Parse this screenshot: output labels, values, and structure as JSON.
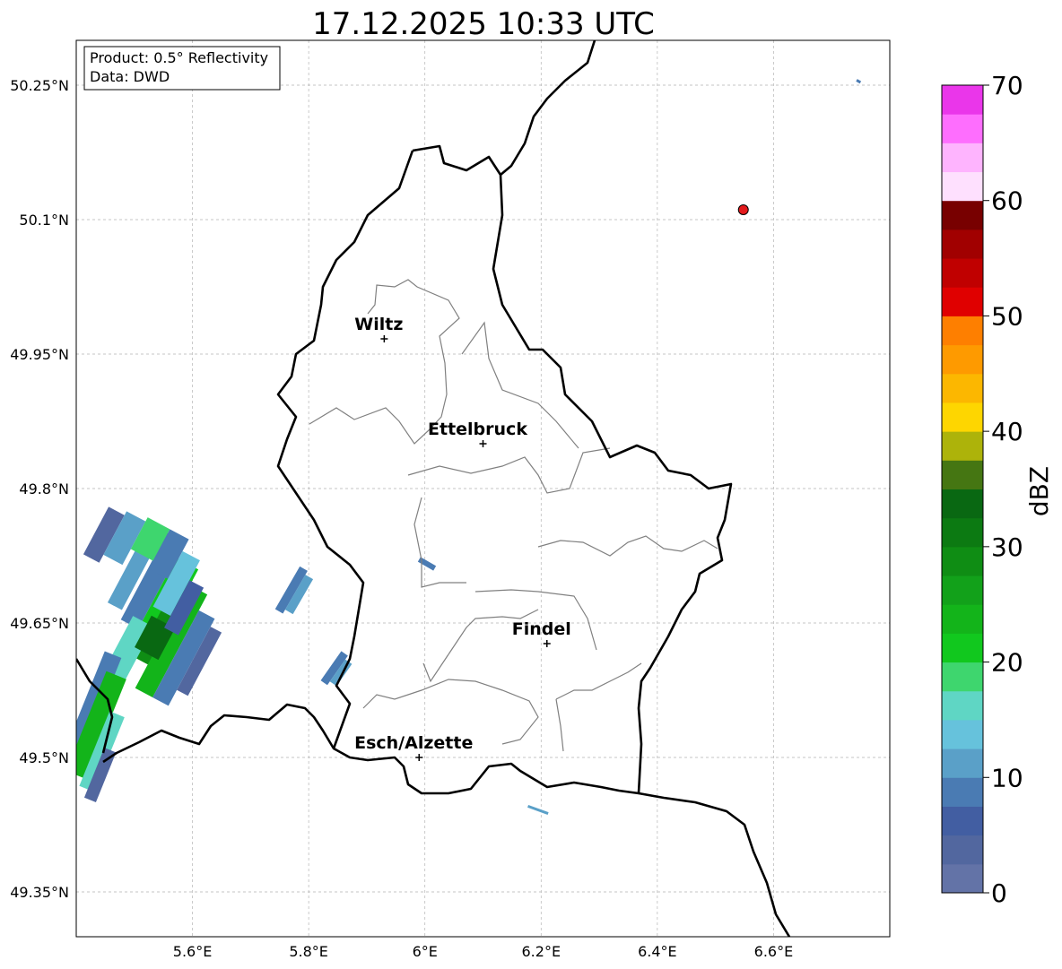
{
  "title": "17.12.2025 10:33 UTC",
  "info_box": {
    "product_line": "Product: 0.5° Reflectivity",
    "data_line": "Data: DWD"
  },
  "map_extent": {
    "lon_min": 5.4,
    "lon_max": 6.8,
    "lat_min": 49.3,
    "lat_max": 50.3
  },
  "lat_ticks": [
    {
      "value": 50.25,
      "label": "50.25°N"
    },
    {
      "value": 50.1,
      "label": "50.1°N"
    },
    {
      "value": 49.95,
      "label": "49.95°N"
    },
    {
      "value": 49.8,
      "label": "49.8°N"
    },
    {
      "value": 49.65,
      "label": "49.65°N"
    },
    {
      "value": 49.5,
      "label": "49.5°N"
    },
    {
      "value": 49.35,
      "label": "49.35°N"
    }
  ],
  "lon_ticks": [
    {
      "value": 5.6,
      "label": "5.6°E"
    },
    {
      "value": 5.8,
      "label": "5.8°E"
    },
    {
      "value": 6.0,
      "label": "6°E"
    },
    {
      "value": 6.2,
      "label": "6.2°E"
    },
    {
      "value": 6.4,
      "label": "6.4°E"
    },
    {
      "value": 6.6,
      "label": "6.6°E"
    }
  ],
  "cities": [
    {
      "name": "Wiltz",
      "lon": 5.93,
      "lat": 49.967
    },
    {
      "name": "Ettelbruck",
      "lon": 6.1,
      "lat": 49.85
    },
    {
      "name": "Findel",
      "lon": 6.21,
      "lat": 49.627
    },
    {
      "name": "Esch/Alzette",
      "lon": 5.99,
      "lat": 49.5
    }
  ],
  "radar_site": {
    "lon": 6.548,
    "lat": 50.111,
    "color": "#e31a1c"
  },
  "colorbar": {
    "label": "dBZ",
    "min": 0,
    "max": 70,
    "step": 2.5,
    "tick_values": [
      0,
      10,
      20,
      30,
      40,
      50,
      60,
      70
    ],
    "tick_labels": [
      "0",
      "10",
      "20",
      "30",
      "40",
      "50",
      "60",
      "70"
    ],
    "colors": [
      "#6373a7",
      "#52679f",
      "#425ea2",
      "#4a7bb3",
      "#5aa0c8",
      "#66c2dc",
      "#5fd6c4",
      "#3ed66e",
      "#11c81e",
      "#13b41a",
      "#12a11a",
      "#0f8d14",
      "#0c7a12",
      "#096812",
      "#457612",
      "#adb30a",
      "#fed600",
      "#fcb700",
      "#fe9a00",
      "#fe7f00",
      "#e00000",
      "#c00000",
      "#a10000",
      "#780000",
      "#fee0fe",
      "#feb4fe",
      "#fe6efe",
      "#ea36ea"
    ]
  },
  "colors": {
    "border": "#000000",
    "canton_lines": "#808080",
    "grid": "#b4b4b4"
  }
}
